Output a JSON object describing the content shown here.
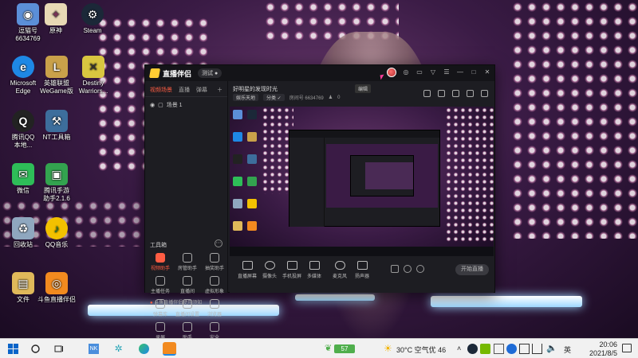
{
  "desktop": {
    "icons": [
      {
        "id": "user",
        "label": "逗猫号\n6634769",
        "color": "#5b8fd8",
        "glyph": "◉"
      },
      {
        "id": "genshin",
        "label": "原神",
        "color": "#e8d9b5",
        "glyph": "✦"
      },
      {
        "id": "steam",
        "label": "Steam",
        "color": "#1b2838",
        "glyph": "⚙"
      },
      {
        "id": "edge",
        "label": "Microsoft\nEdge",
        "color": "#1e88e5",
        "glyph": "e"
      },
      {
        "id": "wegame-lol",
        "label": "英雄联盟\nWeGame版",
        "color": "#c9a14a",
        "glyph": "L"
      },
      {
        "id": "destiny",
        "label": "Destiny\nWarriors...",
        "color": "#d9c640",
        "glyph": "✕"
      },
      {
        "id": "qq",
        "label": "腾讯QQ\n本地...",
        "color": "#222222",
        "glyph": "Q"
      },
      {
        "id": "tools",
        "label": "NT工具箱",
        "color": "#3d6e9c",
        "glyph": "⚒"
      },
      {
        "id": "wechat",
        "label": "微信",
        "color": "#2ebd58",
        "glyph": "✉"
      },
      {
        "id": "app4",
        "label": "腾讯手游\n助手2.1.6",
        "color": "#33a34f",
        "glyph": "▣"
      },
      {
        "id": "recycle",
        "label": "回收站",
        "color": "#8fa7bf",
        "glyph": "♻"
      },
      {
        "id": "qqmusic",
        "label": "QQ音乐",
        "color": "#f2c100",
        "glyph": "♪"
      },
      {
        "id": "files",
        "label": "文件",
        "color": "#e0b95a",
        "glyph": "▤"
      },
      {
        "id": "douyu",
        "label": "斗鱼直播伴侣",
        "color": "#f28a1f",
        "glyph": "◎"
      }
    ]
  },
  "app": {
    "title": "直播伴侣",
    "beta": "测试 ●",
    "tabs": [
      {
        "label": "视频场景",
        "active": true
      },
      {
        "label": "直播",
        "active": false
      },
      {
        "label": "弹幕",
        "active": false
      }
    ],
    "scene": "场景 1",
    "tools_header": "工具箱",
    "tools": [
      {
        "label": "视频助手",
        "active": true
      },
      {
        "label": "房管助手",
        "active": false
      },
      {
        "label": "抽奖助手",
        "active": false
      },
      {
        "label": "主播任务",
        "active": false
      },
      {
        "label": "直播间",
        "active": false
      },
      {
        "label": "虚拟形象",
        "active": false
      },
      {
        "label": "弹幕库",
        "active": false
      },
      {
        "label": "直播间设置",
        "active": false
      },
      {
        "label": "浏览器",
        "active": false
      },
      {
        "label": "录屏",
        "active": false
      },
      {
        "label": "助手",
        "active": false
      },
      {
        "label": "安全",
        "active": false
      }
    ],
    "notice": "斗鱼直播伴侣使用须知",
    "room": {
      "title": "好明星的发现时光",
      "badge": "编辑",
      "meta": [
        "娱乐天地",
        "分类 ✓",
        "房间号 6634769"
      ],
      "viewers": "0"
    },
    "bottom": [
      {
        "id": "screen",
        "label": "直播屏幕"
      },
      {
        "id": "camera",
        "label": "摄像头"
      },
      {
        "id": "phone",
        "label": "手机投屏"
      },
      {
        "id": "media",
        "label": "多媒体"
      },
      {
        "id": "mic",
        "label": "麦克风"
      },
      {
        "id": "speaker",
        "label": "扬声器"
      }
    ],
    "go_live": "开始直播"
  },
  "taskbar": {
    "battery": "57",
    "weather": "30°C  空气优 46",
    "lang": "英",
    "time": "20:06",
    "date": "2021/8/5"
  }
}
